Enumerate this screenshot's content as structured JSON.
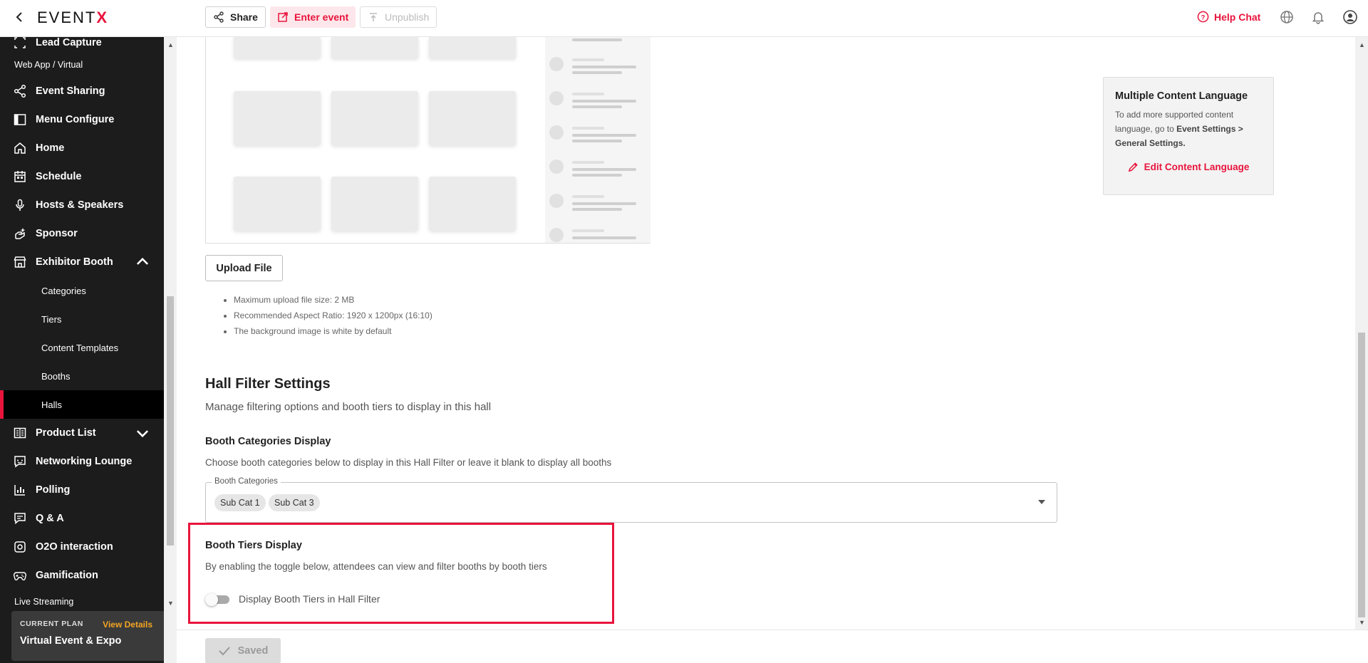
{
  "topbar": {
    "logo_left": "EVENT",
    "logo_right": "X",
    "share_label": "Share",
    "enter_label": "Enter event",
    "unpublish_label": "Unpublish",
    "help_label": "Help Chat"
  },
  "sidebar": {
    "lead_capture": "Lead Capture",
    "section_web": "Web App / Virtual",
    "items": [
      {
        "label": "Event Sharing",
        "icon": "share-icon"
      },
      {
        "label": "Menu Configure",
        "icon": "layout-icon"
      },
      {
        "label": "Home",
        "icon": "home-icon"
      },
      {
        "label": "Schedule",
        "icon": "calendar-icon"
      },
      {
        "label": "Hosts & Speakers",
        "icon": "microphone-icon"
      },
      {
        "label": "Sponsor",
        "icon": "sponsor-icon"
      },
      {
        "label": "Exhibitor Booth",
        "icon": "store-icon"
      }
    ],
    "sub_items": [
      "Categories",
      "Tiers",
      "Content Templates",
      "Booths",
      "Halls"
    ],
    "more_items": [
      {
        "label": "Product List",
        "icon": "product-list-icon"
      },
      {
        "label": "Networking Lounge",
        "icon": "chat-icon"
      },
      {
        "label": "Polling",
        "icon": "bar-chart-icon"
      },
      {
        "label": "Q & A",
        "icon": "qa-icon"
      },
      {
        "label": "O2O interaction",
        "icon": "o2o-icon"
      },
      {
        "label": "Gamification",
        "icon": "gamepad-icon"
      }
    ],
    "section_live": "Live Streaming",
    "plan": {
      "label": "CURRENT PLAN",
      "view_details": "View Details",
      "name": "Virtual Event & Expo"
    }
  },
  "upload": {
    "button": "Upload File",
    "hints": [
      "Maximum upload file size: 2 MB",
      "Recommended Aspect Ratio: 1920 x 1200px (16:10)",
      "The background image is white by default"
    ]
  },
  "hall_filter": {
    "title": "Hall Filter Settings",
    "subtitle": "Manage filtering options and booth tiers to display in this hall",
    "categories_title": "Booth Categories Display",
    "categories_desc": "Choose booth categories below to display in this Hall Filter or leave it blank to display all booths",
    "select_legend": "Booth Categories",
    "chips": [
      "Sub Cat 1",
      "Sub Cat 3"
    ],
    "tiers_title": "Booth Tiers Display",
    "tiers_desc": "By enabling the toggle below, attendees can view and filter booths by booth tiers",
    "toggle_label": "Display Booth Tiers in Hall Filter",
    "toggle_on": false
  },
  "language_card": {
    "title": "Multiple Content Language",
    "body_1": "To add more supported content language, go to ",
    "body_bold": "Event Settings > General Settings.",
    "edit_label": "Edit Content Language"
  },
  "footer": {
    "saved_label": "Saved"
  },
  "colors": {
    "accent": "#e8143c",
    "sidebar_bg": "#1c1c1c",
    "plan_link": "#f5a524"
  }
}
